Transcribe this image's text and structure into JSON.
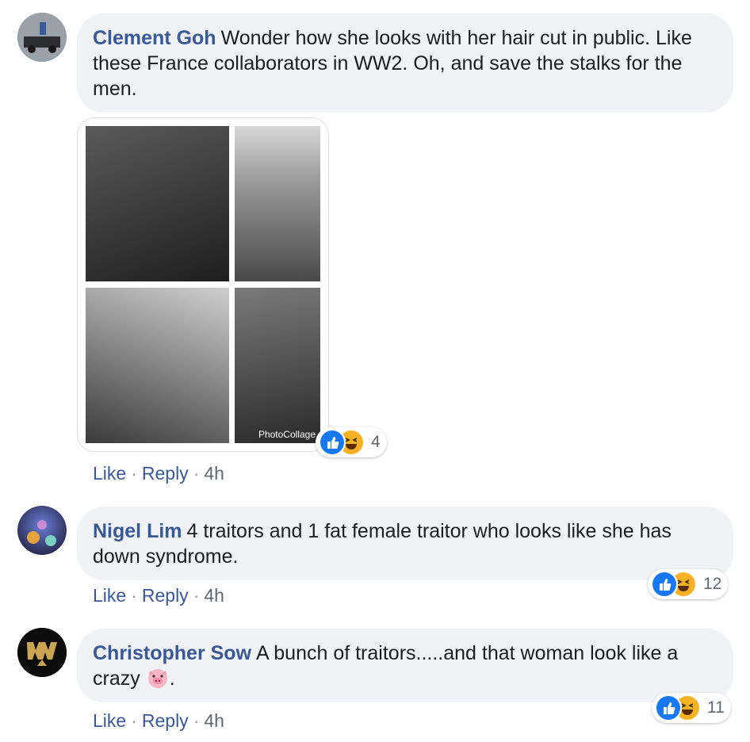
{
  "comments": [
    {
      "author": "Clement Goh",
      "text": "Wonder how she looks with her hair cut in public. Like these France collaborators in WW2. Oh, and save the stalks for the men.",
      "actions": {
        "like": "Like",
        "reply": "Reply",
        "sep": "·",
        "time": "4h"
      },
      "reactions": {
        "count": "4",
        "icons": [
          "like-icon",
          "haha-icon"
        ]
      },
      "attachment": {
        "watermark": "PhotoCollage"
      }
    },
    {
      "author": "Nigel Lim",
      "text": "4 traitors and 1 fat female traitor who looks like she has down syndrome.",
      "actions": {
        "like": "Like",
        "reply": "Reply",
        "sep": "·",
        "time": "4h"
      },
      "reactions": {
        "count": "12",
        "icons": [
          "like-icon",
          "haha-icon"
        ]
      }
    },
    {
      "author": "Christopher Sow",
      "text": "A bunch of traitors.....and that woman look like a crazy",
      "emoji": "🐷",
      "text_end": ".",
      "actions": {
        "like": "Like",
        "reply": "Reply",
        "sep": "·",
        "time": "4h"
      },
      "reactions": {
        "count": "11",
        "icons": [
          "like-icon",
          "haha-icon"
        ]
      }
    }
  ],
  "colors": {
    "link": "#385898",
    "bubble": "#f0f2f5",
    "like": "#1877f2",
    "haha": "#f7b125"
  }
}
